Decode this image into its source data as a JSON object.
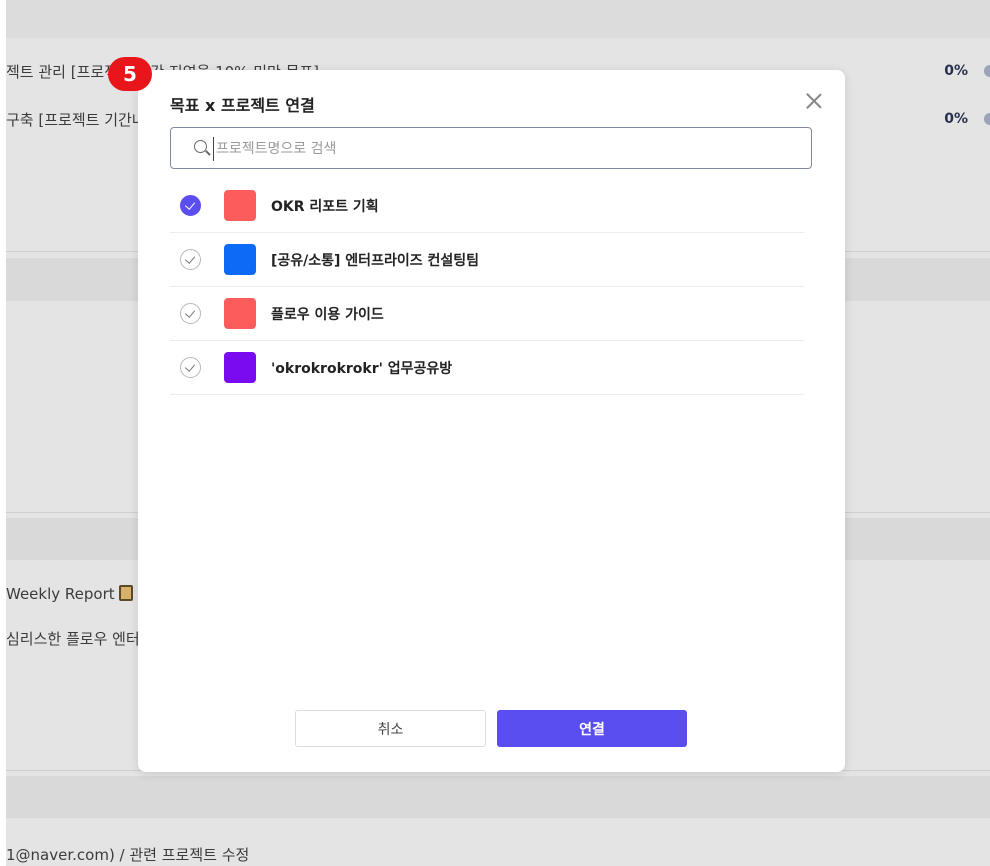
{
  "background": {
    "rows": [
      {
        "text": "젝트 관리 [프로젝트 기간 지연율 10% 미만 목표]",
        "percent": "0%"
      },
      {
        "text": "구축 [프로젝트 기간내",
        "percent": "0%"
      }
    ],
    "weekly_report": "Weekly Report",
    "weekly_sub": "심리스한 플로우 엔터",
    "footer_text": "1@naver.com) / 관련 프로젝트 수정"
  },
  "step_badge": "5",
  "modal": {
    "title": "목표 x 프로젝트 연결",
    "search": {
      "placeholder": "프로젝트명으로 검색",
      "value": ""
    },
    "projects": [
      {
        "name": "OKR 리포트 기획",
        "color": "#fd5c5c",
        "checked": true
      },
      {
        "name": "[공유/소통] 엔터프라이즈 컨설팅팀",
        "color": "#0b6bf7",
        "checked": false
      },
      {
        "name": "플로우 이용 가이드",
        "color": "#fd5c5c",
        "checked": false
      },
      {
        "name": "'okrokrokrokr' 업무공유방",
        "color": "#7a0af0",
        "checked": false
      }
    ],
    "cancel_label": "취소",
    "connect_label": "연결"
  },
  "colors": {
    "accent": "#5b4ef0",
    "badge": "#e8161b"
  }
}
